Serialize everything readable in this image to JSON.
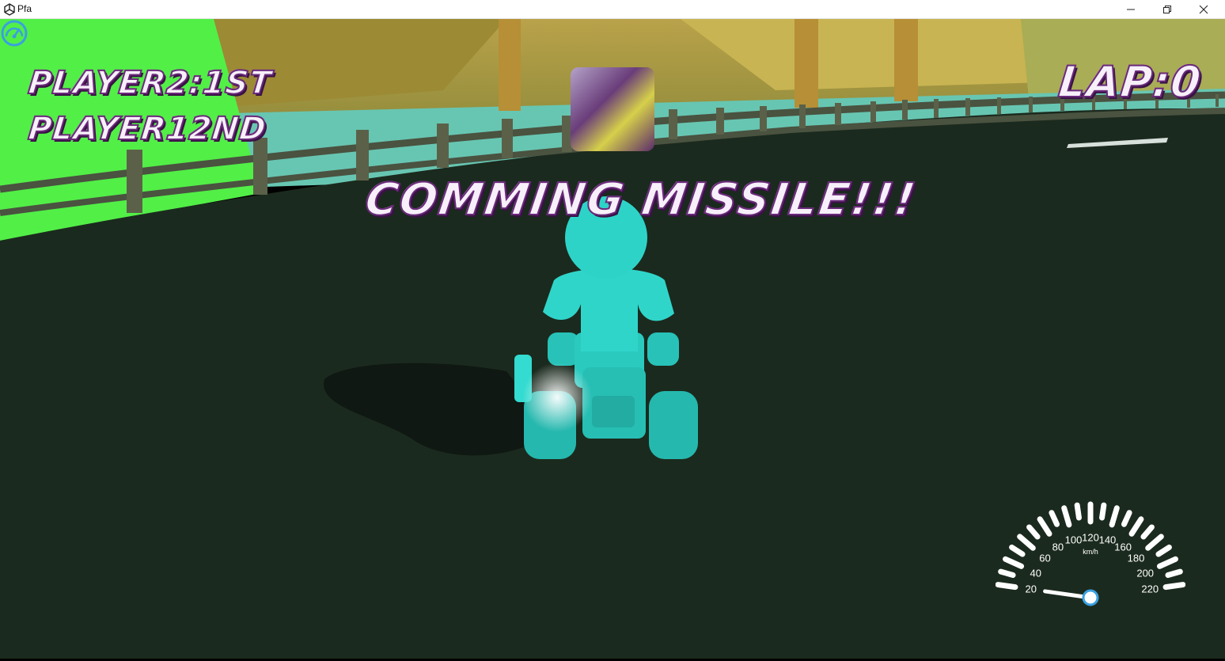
{
  "window": {
    "title": "Pfa",
    "app_icon": "unity-icon",
    "controls": [
      "minimize-icon",
      "restore-icon",
      "close-icon"
    ]
  },
  "hud": {
    "rank_lines": [
      "PLAYER2:1ST",
      "PLAYER12ND"
    ],
    "lap": "LAP:0",
    "warning": "COMMING MISSILE!!!",
    "item_slot": "empty"
  },
  "speedometer": {
    "labels": [
      "20",
      "40",
      "60",
      "80",
      "100",
      "120",
      "140",
      "160",
      "180",
      "200",
      "220"
    ],
    "unit": "km/h",
    "min": 20,
    "max": 220,
    "current_speed": 20,
    "icon": "speedometer-icon",
    "accent_color": "#3aa0e0"
  },
  "colors": {
    "hud_text": "#f7f0fa",
    "hud_outline": "#6a2a7a",
    "kart": "#2ed3c8",
    "track": "#1b2a1e",
    "grass": "#52ef47"
  }
}
